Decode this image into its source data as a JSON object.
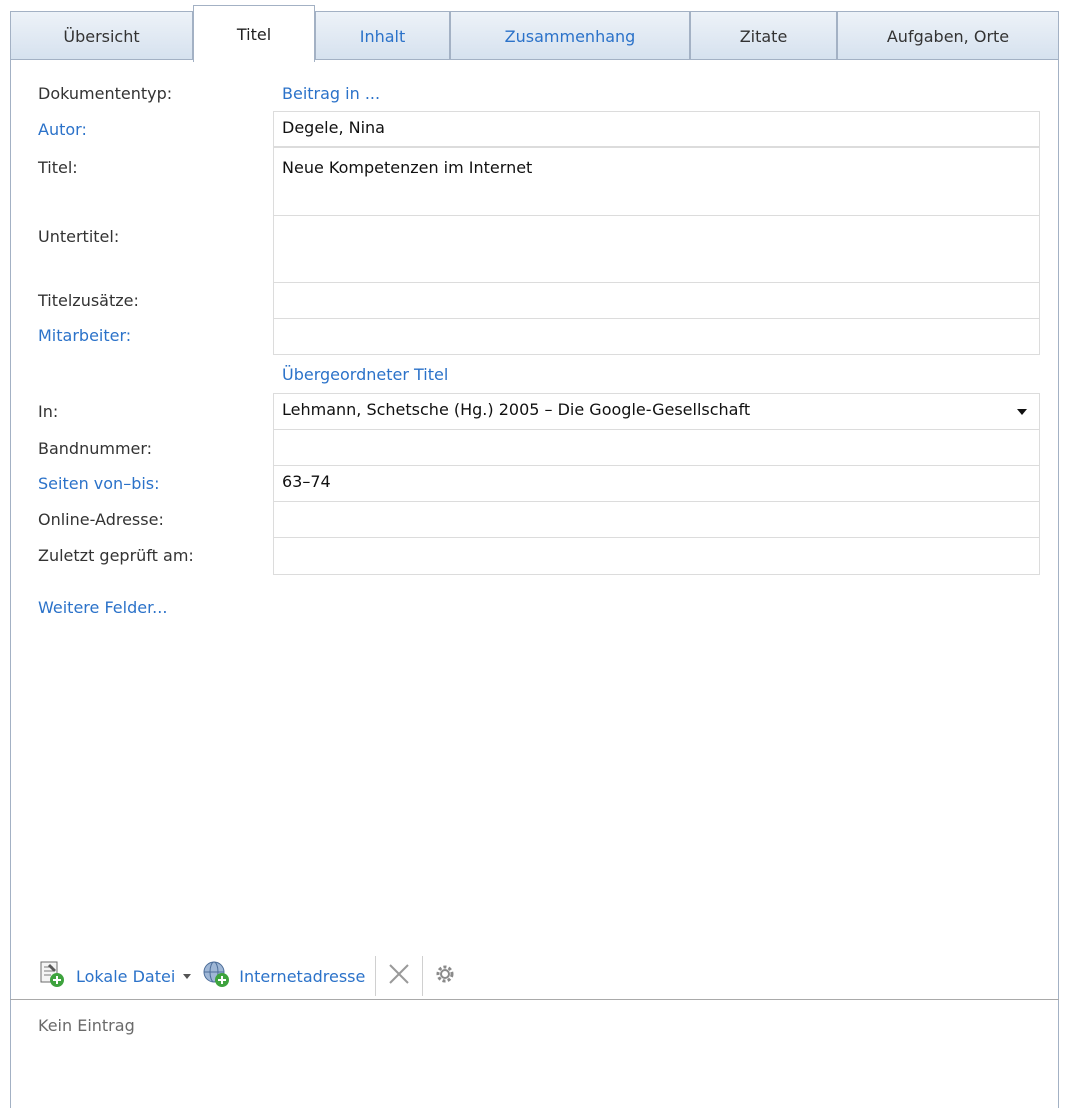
{
  "tabs": [
    {
      "label": "Übersicht"
    },
    {
      "label": "Titel"
    },
    {
      "label": "Inhalt"
    },
    {
      "label": "Zusammenhang"
    },
    {
      "label": "Zitate"
    },
    {
      "label": "Aufgaben, Orte"
    }
  ],
  "form": {
    "doctype_label": "Dokumententyp:",
    "doctype_value": "Beitrag in ...",
    "author_label": "Autor:",
    "author_value": "Degele, Nina",
    "title_label": "Titel:",
    "title_value": "Neue Kompetenzen im Internet",
    "subtitle_label": "Untertitel:",
    "subtitle_value": "",
    "title_additions_label": "Titelzusätze:",
    "title_additions_value": "",
    "contributors_label": "Mitarbeiter:",
    "contributors_value": "",
    "parent_title_link": "Übergeordneter Titel",
    "in_label": "In:",
    "in_value": "Lehmann, Schetsche (Hg.) 2005 – Die Google-Gesellschaft",
    "volume_label": "Bandnummer:",
    "volume_value": "",
    "pages_label": "Seiten von–bis:",
    "pages_value": "63–74",
    "online_label": "Online-Adresse:",
    "online_value": "",
    "checked_label": "Zuletzt geprüft am:",
    "checked_value": "",
    "more_fields": "Weitere Felder..."
  },
  "attachments": {
    "local_file": "Lokale Datei",
    "web_address": "Internetadresse",
    "empty": "Kein Eintrag"
  },
  "icons": {
    "local_file": "file-add-icon",
    "web_address": "globe-add-icon",
    "delete": "close-icon",
    "settings": "gear-icon"
  },
  "colors": {
    "link": "#2b72c9",
    "tab_border": "#a3b1c4"
  }
}
